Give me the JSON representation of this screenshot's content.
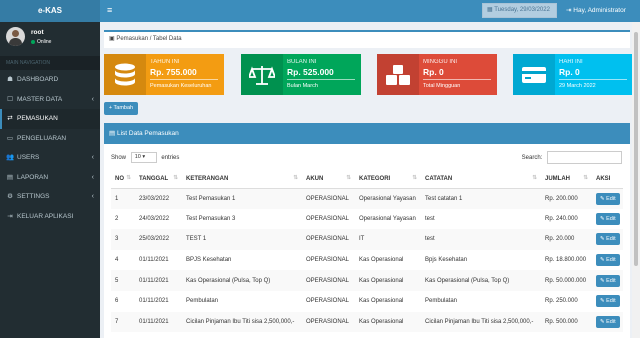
{
  "app": {
    "logo": "e-KAS"
  },
  "user": {
    "name": "root",
    "status": "Online"
  },
  "sidebar": {
    "header": "MAIN NAVIGATION",
    "items": [
      {
        "label": "DASHBOARD",
        "icon": "dashboard-icon",
        "chevron": "",
        "active": false
      },
      {
        "label": "MASTER DATA",
        "icon": "square-icon",
        "chevron": "‹",
        "active": false
      },
      {
        "label": "PEMASUKAN",
        "icon": "exchange-icon",
        "chevron": "",
        "active": true
      },
      {
        "label": "PENGELUARAN",
        "icon": "money-icon",
        "chevron": "",
        "active": false
      },
      {
        "label": "USERS",
        "icon": "users-icon",
        "chevron": "‹",
        "active": false
      },
      {
        "label": "LAPORAN",
        "icon": "file-icon",
        "chevron": "‹",
        "active": false
      },
      {
        "label": "SETTINGS",
        "icon": "gear-icon",
        "chevron": "‹",
        "active": false
      },
      {
        "label": "KELUAR APLIKASI",
        "icon": "sign-out-icon",
        "chevron": "",
        "active": false
      }
    ]
  },
  "topbar": {
    "date": "Tuesday, 29/03/2022",
    "user_label": "Hay, Administrator"
  },
  "breadcrumb": "Pemasukan / Tabel Data",
  "cards": [
    {
      "label": "TAHUN INI",
      "value": "Rp. 755.000",
      "sub": "Pemasukan Keseluruhan",
      "color": "#f39c12",
      "icon": "database-icon"
    },
    {
      "label": "BULAN INI",
      "value": "Rp. 525.000",
      "sub": "Bulan March",
      "color": "#00a65a",
      "icon": "balance-scale-icon"
    },
    {
      "label": "MINGGU INI",
      "value": "Rp. 0",
      "sub": "Total Mingguan",
      "color": "#dd4b39",
      "icon": "cubes-icon"
    },
    {
      "label": "HARI INI",
      "value": "Rp. 0",
      "sub": "29 March 2022",
      "color": "#00c0ef",
      "icon": "credit-card-icon"
    }
  ],
  "buttons": {
    "tambah": "+ Tambah",
    "edit": "✎ Edit"
  },
  "panel": {
    "title": "List Data Pemasukan",
    "show_label": "Show",
    "show_value": "10",
    "entries_label": "entries",
    "search_label": "Search:"
  },
  "table": {
    "headers": [
      "NO",
      "TANGGAL",
      "KETERANGAN",
      "AKUN",
      "KATEGORI",
      "CATATAN",
      "JUMLAH",
      "AKSI"
    ],
    "rows": [
      [
        "1",
        "23/03/2022",
        "Test Pemasukan 1",
        "OPERASIONAL",
        "Operasional Yayasan",
        "Test catatan 1",
        "Rp. 200.000"
      ],
      [
        "2",
        "24/03/2022",
        "Test Pemasukan 3",
        "OPERASIONAL",
        "Operasional Yayasan",
        "test",
        "Rp. 240.000"
      ],
      [
        "3",
        "25/03/2022",
        "TEST 1",
        "OPERASIONAL",
        "IT",
        "test",
        "Rp. 20.000"
      ],
      [
        "4",
        "01/11/2021",
        "BPJS Kesehatan",
        "OPERASIONAL",
        "Kas Operasional",
        "Bpjs Kesehatan",
        "Rp. 18.800.000"
      ],
      [
        "5",
        "01/11/2021",
        "Kas Operasional (Pulsa, Top Q)",
        "OPERASIONAL",
        "Kas Operasional",
        "Kas Operasional (Pulsa, Top Q)",
        "Rp. 50.000.000"
      ],
      [
        "6",
        "01/11/2021",
        "Pembulatan",
        "OPERASIONAL",
        "Kas Operasional",
        "Pembulatan",
        "Rp. 250.000"
      ],
      [
        "7",
        "01/11/2021",
        "Cicilan Pinjaman Ibu Titi sisa 2,500,000,-",
        "OPERASIONAL",
        "Kas Operasional",
        "Cicilan Pinjaman Ibu Titi sisa 2,500,000,-",
        "Rp. 500.000"
      ]
    ]
  }
}
